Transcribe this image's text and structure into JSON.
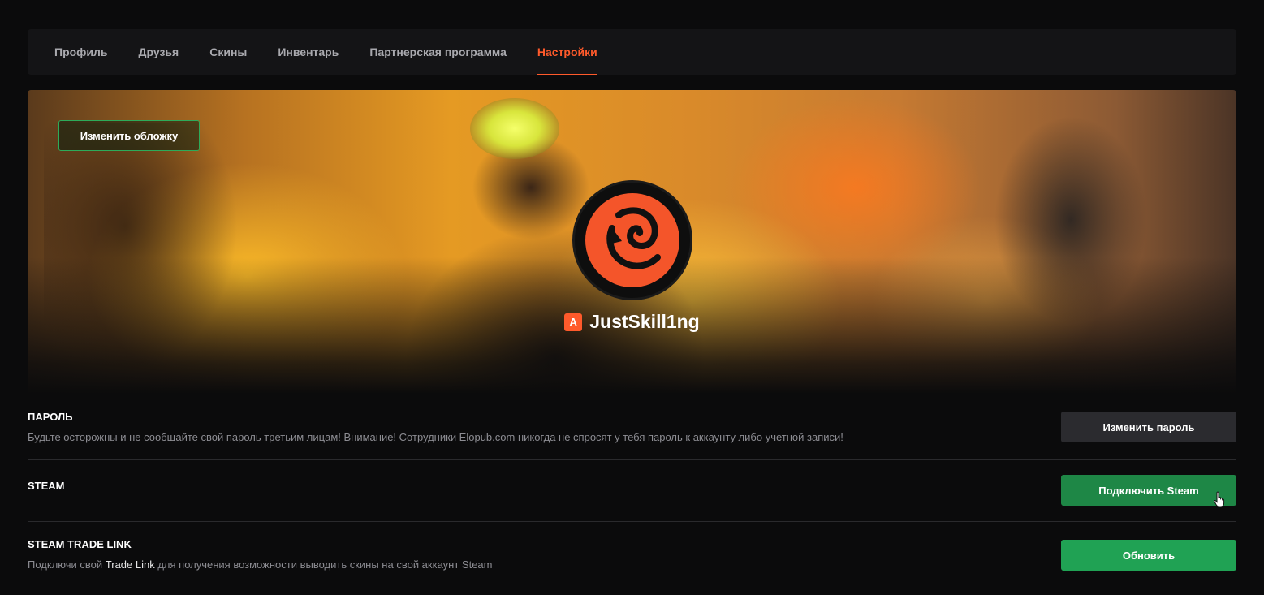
{
  "nav": {
    "tabs": [
      {
        "label": "Профиль",
        "active": false
      },
      {
        "label": "Друзья",
        "active": false
      },
      {
        "label": "Скины",
        "active": false
      },
      {
        "label": "Инвентарь",
        "active": false
      },
      {
        "label": "Партнерская программа",
        "active": false
      },
      {
        "label": "Настройки",
        "active": true
      }
    ]
  },
  "cover": {
    "change_cover_label": "Изменить обложку",
    "username": "JustSkill1ng",
    "rank_letter": "A"
  },
  "settings": {
    "password": {
      "title": "ПАРОЛЬ",
      "description": "Будьте осторожны и не сообщайте свой пароль третьим лицам! Внимание! Сотрудники Elopub.com никогда не спросят у тебя пароль к аккаунту либо учетной записи!",
      "button": "Изменить пароль"
    },
    "steam": {
      "title": "STEAM",
      "button": "Подключить Steam"
    },
    "trade_link": {
      "title": "STEAM TRADE LINK",
      "description_before": "Подключи свой ",
      "description_link": "Trade Link",
      "description_after": " для получения возможности выводить скины на свой аккаунт Steam",
      "button": "Обновить"
    }
  },
  "colors": {
    "accent": "#ff5a2b",
    "green": "#20a254",
    "background": "#0b0b0c"
  }
}
